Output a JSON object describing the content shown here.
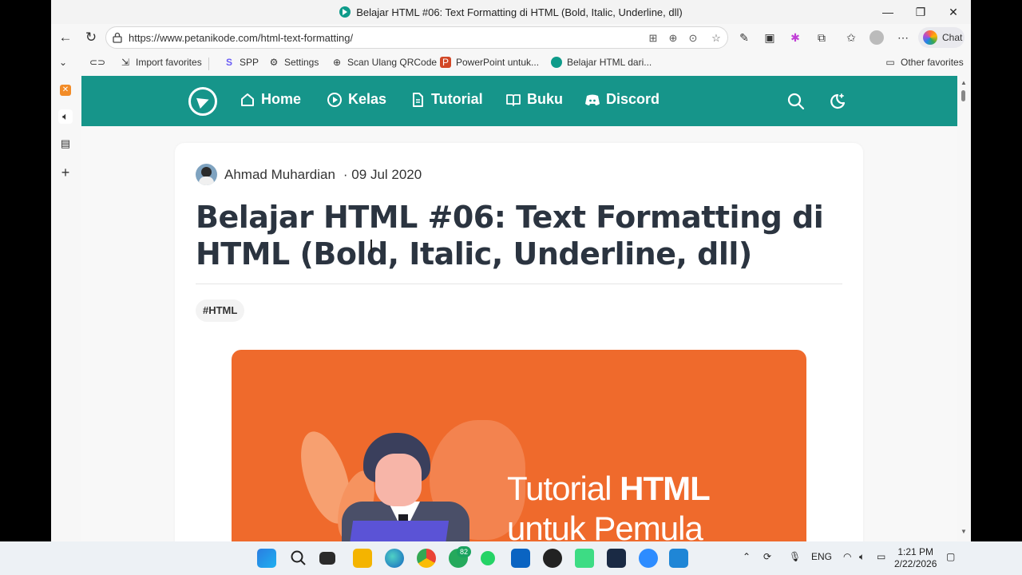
{
  "browser": {
    "window_title": "Belajar HTML #06: Text Formatting di HTML (Bold, Italic, Underline, dll)",
    "url": "https://www.petanikode.com/html-text-formatting/",
    "chat_label": "Chat",
    "accent": "#16958a"
  },
  "favorites": {
    "items": [
      {
        "label": "Import favorites",
        "icon": "import-icon"
      },
      {
        "label": "SPP",
        "icon": "s-logo-icon"
      },
      {
        "label": "Settings",
        "icon": "gear-icon"
      },
      {
        "label": "Scan Ulang QRCode",
        "icon": "globe-icon"
      },
      {
        "label": "PowerPoint untuk...",
        "icon": "powerpoint-icon"
      },
      {
        "label": "Belajar HTML dari...",
        "icon": "petanikode-icon"
      }
    ],
    "other_label": "Other favorites"
  },
  "site_nav": {
    "items": [
      {
        "label": "Home",
        "icon": "home-icon"
      },
      {
        "label": "Kelas",
        "icon": "play-circle-icon"
      },
      {
        "label": "Tutorial",
        "icon": "document-icon"
      },
      {
        "label": "Buku",
        "icon": "book-icon"
      },
      {
        "label": "Discord",
        "icon": "discord-icon"
      }
    ]
  },
  "article": {
    "author": "Ahmad Muhardian",
    "date": "· 09 Jul 2020",
    "title_line1": "Belajar HTML #06: Text Formatting di",
    "title_line2": "HTML (Bold, Italic, Underline, dll)",
    "tag": "#HTML",
    "banner_line1_normal": "Tutorial ",
    "banner_line1_bold": "HTML",
    "banner_line2": "untuk Pemula",
    "banner_color": "#ef6a2c"
  },
  "taskbar": {
    "lang": "ENG",
    "time": "1:21 PM",
    "date": "2/22/2026",
    "whatsapp_badge": "82"
  }
}
